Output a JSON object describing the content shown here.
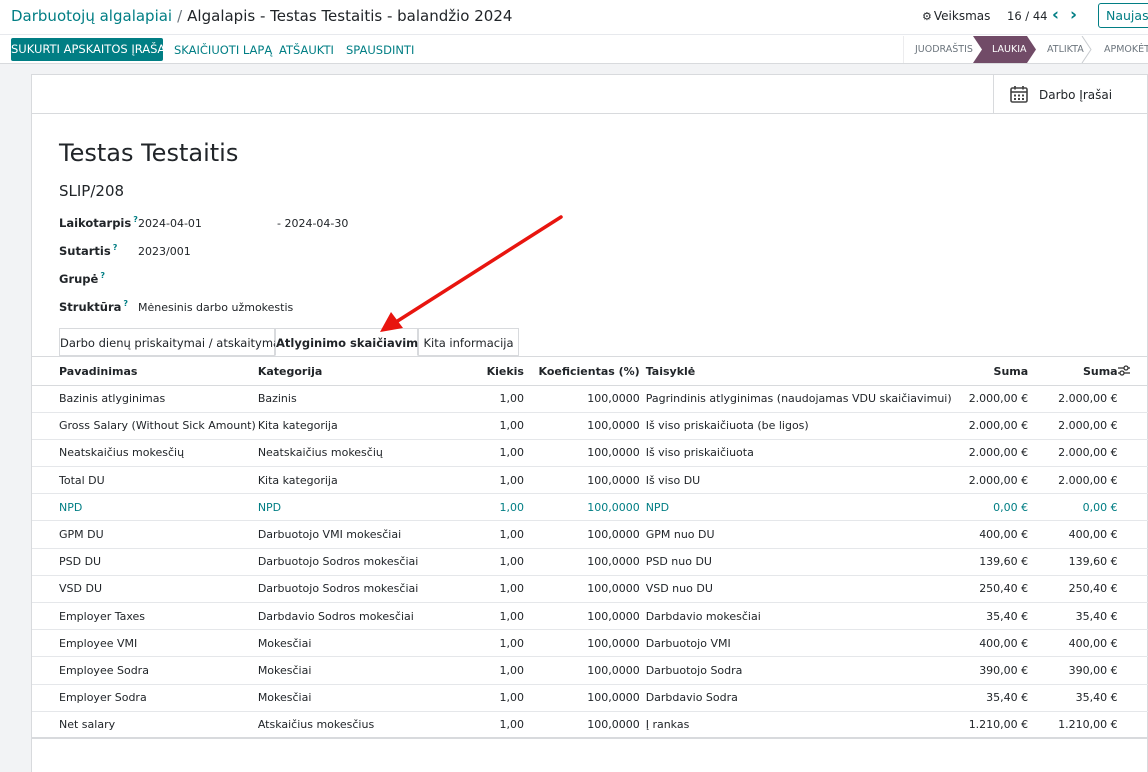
{
  "breadcrumb": {
    "parent": "Darbuotojų algalapiai",
    "separator": "/",
    "current": "Algalapis - Testas Testaitis - balandžio 2024"
  },
  "toolbar": {
    "actions_label": "Veiksmas",
    "pager_value": "16 / 44",
    "new_label": "Naujas"
  },
  "buttons": {
    "create_entry": "SUKURTI APSKAITOS ĮRAŠĄ",
    "compute": "SKAIČIUOTI LAPĄ",
    "cancel": "ATŠAUKTI",
    "print": "SPAUSDINTI"
  },
  "statusbar": {
    "stages": [
      "JUODRAŠTIS",
      "LAUKIA",
      "ATLIKTA",
      "APMOKĖTA"
    ],
    "active_index": 1,
    "active_color": "#714b67"
  },
  "smart_button": {
    "label": "Darbo Įrašai",
    "icon": "calendar-icon"
  },
  "form": {
    "employee_name": "Testas Testaitis",
    "slip_number": "SLIP/208",
    "period_label": "Laikotarpis",
    "period_from": "2024-04-01",
    "period_to": "- 2024-04-30",
    "contract_label": "Sutartis",
    "contract_value": "2023/001",
    "group_label": "Grupė",
    "group_value": "",
    "structure_label": "Struktūra",
    "structure_value": "Mėnesinis darbo užmokestis",
    "help_mark": "?"
  },
  "tabs": [
    {
      "label": "Darbo dienų priskaitymai / atskaitymai",
      "active": false
    },
    {
      "label": "Atlyginimo skaičiavimas",
      "active": true
    },
    {
      "label": "Kita informacija",
      "active": false
    }
  ],
  "table": {
    "headers": {
      "name": "Pavadinimas",
      "category": "Kategorija",
      "quantity": "Kiekis",
      "rate": "Koeficientas (%)",
      "rule": "Taisyklė",
      "amount": "Suma",
      "total": "Suma"
    },
    "rows": [
      {
        "name": "Bazinis atlyginimas",
        "category": "Bazinis",
        "quantity": "1,00",
        "rate": "100,0000",
        "rule": "Pagrindinis atlyginimas (naudojamas VDU skaičiavimui)",
        "amount": "2.000,00 €",
        "total": "2.000,00 €",
        "highlight": false
      },
      {
        "name": "Gross Salary (Without Sick Amount)",
        "category": "Kita kategorija",
        "quantity": "1,00",
        "rate": "100,0000",
        "rule": "Iš viso priskaičiuota (be ligos)",
        "amount": "2.000,00 €",
        "total": "2.000,00 €",
        "highlight": false
      },
      {
        "name": "Neatskaičius mokesčių",
        "category": "Neatskaičius mokesčių",
        "quantity": "1,00",
        "rate": "100,0000",
        "rule": "Iš viso priskaičiuota",
        "amount": "2.000,00 €",
        "total": "2.000,00 €",
        "highlight": false
      },
      {
        "name": "Total DU",
        "category": "Kita kategorija",
        "quantity": "1,00",
        "rate": "100,0000",
        "rule": "Iš viso DU",
        "amount": "2.000,00 €",
        "total": "2.000,00 €",
        "highlight": false
      },
      {
        "name": "NPD",
        "category": "NPD",
        "quantity": "1,00",
        "rate": "100,0000",
        "rule": "NPD",
        "amount": "0,00 €",
        "total": "0,00 €",
        "highlight": true
      },
      {
        "name": "GPM DU",
        "category": "Darbuotojo VMI mokesčiai",
        "quantity": "1,00",
        "rate": "100,0000",
        "rule": "GPM nuo DU",
        "amount": "400,00 €",
        "total": "400,00 €",
        "highlight": false
      },
      {
        "name": "PSD DU",
        "category": "Darbuotojo Sodros mokesčiai",
        "quantity": "1,00",
        "rate": "100,0000",
        "rule": "PSD nuo DU",
        "amount": "139,60 €",
        "total": "139,60 €",
        "highlight": false
      },
      {
        "name": "VSD DU",
        "category": "Darbuotojo Sodros mokesčiai",
        "quantity": "1,00",
        "rate": "100,0000",
        "rule": "VSD nuo DU",
        "amount": "250,40 €",
        "total": "250,40 €",
        "highlight": false
      },
      {
        "name": "Employer Taxes",
        "category": "Darbdavio Sodros mokesčiai",
        "quantity": "1,00",
        "rate": "100,0000",
        "rule": "Darbdavio mokesčiai",
        "amount": "35,40 €",
        "total": "35,40 €",
        "highlight": false
      },
      {
        "name": "Employee VMI",
        "category": "Mokesčiai",
        "quantity": "1,00",
        "rate": "100,0000",
        "rule": "Darbuotojo VMI",
        "amount": "400,00 €",
        "total": "400,00 €",
        "highlight": false
      },
      {
        "name": "Employee Sodra",
        "category": "Mokesčiai",
        "quantity": "1,00",
        "rate": "100,0000",
        "rule": "Darbuotojo Sodra",
        "amount": "390,00 €",
        "total": "390,00 €",
        "highlight": false
      },
      {
        "name": "Employer Sodra",
        "category": "Mokesčiai",
        "quantity": "1,00",
        "rate": "100,0000",
        "rule": "Darbdavio Sodra",
        "amount": "35,40 €",
        "total": "35,40 €",
        "highlight": false
      },
      {
        "name": "Net salary",
        "category": "Atskaičius mokesčius",
        "quantity": "1,00",
        "rate": "100,0000",
        "rule": "Į rankas",
        "amount": "1.210,00 €",
        "total": "1.210,00 €",
        "highlight": false
      }
    ]
  },
  "colors": {
    "primary": "#017e84",
    "stage_active": "#714b67",
    "annotation_arrow": "#e8150f"
  }
}
